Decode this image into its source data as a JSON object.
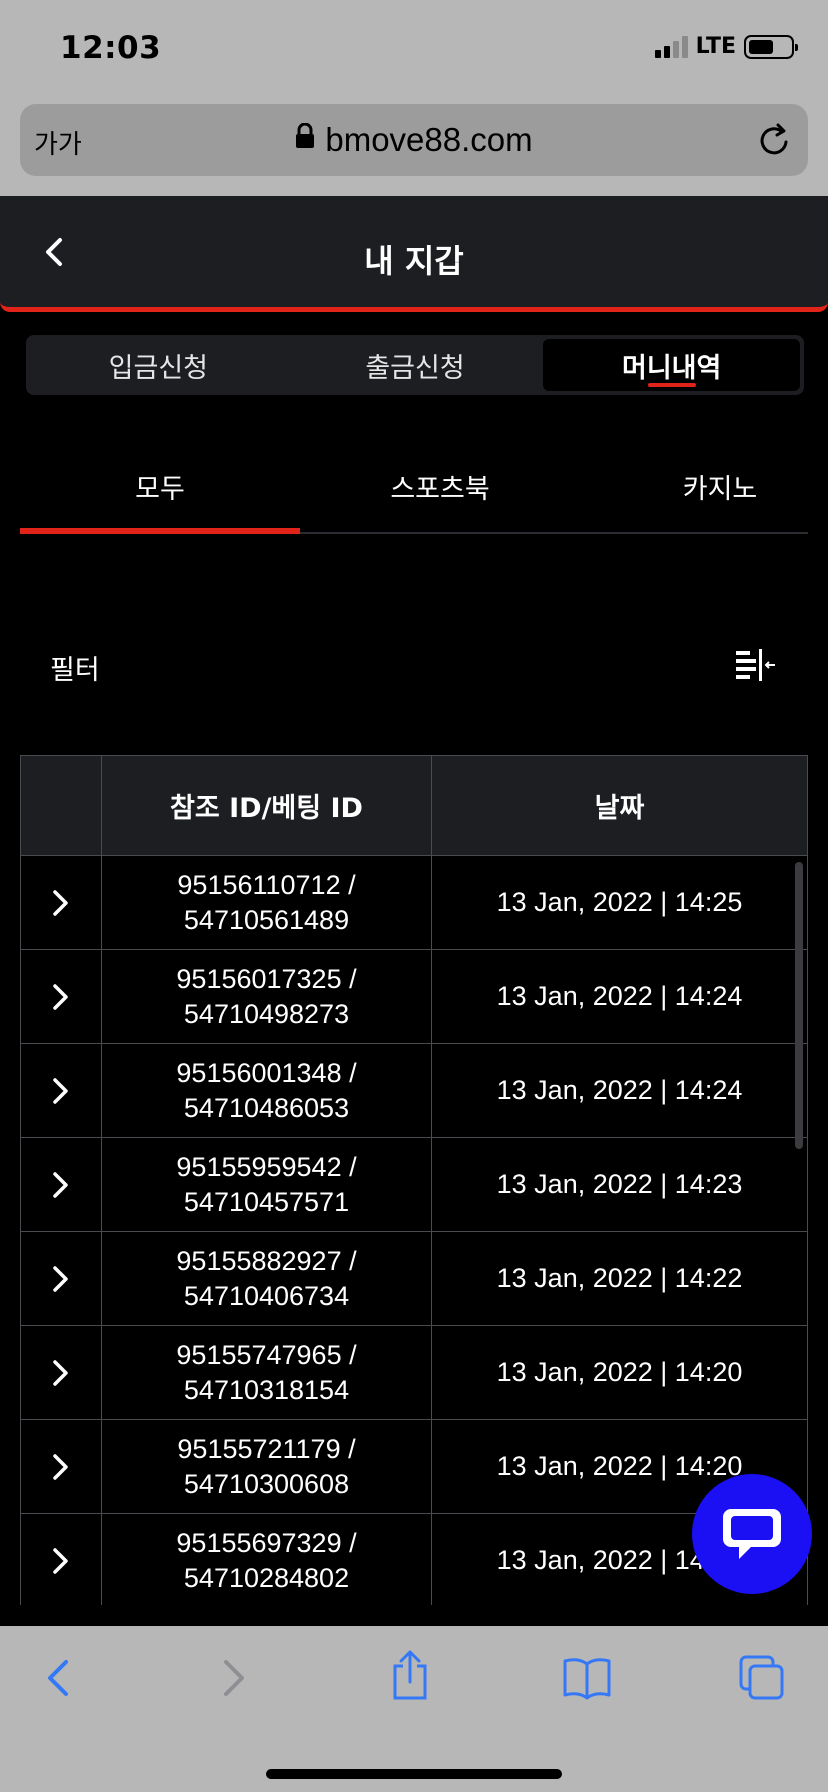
{
  "status_bar": {
    "time": "12:03",
    "network": "LTE"
  },
  "browser": {
    "text_size": "가가",
    "url": "bmove88.com"
  },
  "header": {
    "title": "내 지갑"
  },
  "segments": [
    {
      "label": "입금신청",
      "active": false
    },
    {
      "label": "출금신청",
      "active": false
    },
    {
      "label": "머니내역",
      "active": true
    }
  ],
  "subtabs": [
    {
      "label": "모두",
      "active": true
    },
    {
      "label": "스포츠북",
      "active": false
    },
    {
      "label": "카지노",
      "active": false
    }
  ],
  "filter": {
    "label": "필터"
  },
  "table": {
    "headers": [
      "",
      "참조 ID/베팅 ID",
      "날짜"
    ],
    "rows": [
      {
        "ref": "95156110712 /",
        "bet": "54710561489",
        "date": "13 Jan, 2022 | 14:25"
      },
      {
        "ref": "95156017325 /",
        "bet": "54710498273",
        "date": "13 Jan, 2022 | 14:24"
      },
      {
        "ref": "95156001348 /",
        "bet": "54710486053",
        "date": "13 Jan, 2022 | 14:24"
      },
      {
        "ref": "95155959542 /",
        "bet": "54710457571",
        "date": "13 Jan, 2022 | 14:23"
      },
      {
        "ref": "95155882927 /",
        "bet": "54710406734",
        "date": "13 Jan, 2022 | 14:22"
      },
      {
        "ref": "95155747965 /",
        "bet": "54710318154",
        "date": "13 Jan, 2022 | 14:20"
      },
      {
        "ref": "95155721179 /",
        "bet": "54710300608",
        "date": "13 Jan, 2022 | 14:20"
      },
      {
        "ref": "95155697329 /",
        "bet": "54710284802",
        "date": "13 Jan, 2022 | 14:19"
      }
    ]
  },
  "colors": {
    "accent": "#e2231a",
    "chat": "#1a10f3",
    "panel": "#1d1e22",
    "safari_blue": "#3478f6"
  },
  "icons": [
    "back-icon",
    "filter-icon",
    "chevron-right-icon",
    "chat-icon",
    "lock-icon",
    "reload-icon",
    "share-icon",
    "bookmarks-icon",
    "tabs-icon"
  ]
}
